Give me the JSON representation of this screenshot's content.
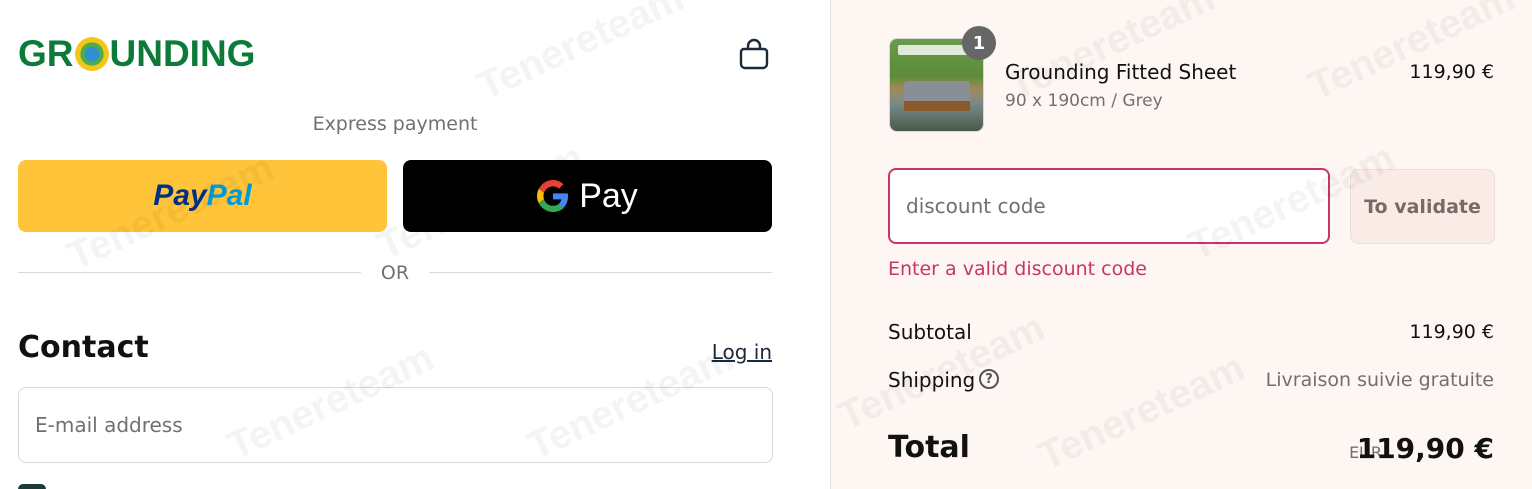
{
  "brand": {
    "logo_text_before": "GR",
    "logo_text_after": "UNDING",
    "color": "#0d7a3a"
  },
  "header": {
    "cart_icon": "shopping-bag-icon"
  },
  "express": {
    "label": "Express payment",
    "paypal": {
      "part1": "Pay",
      "part2": "Pal",
      "color": "#ffc439"
    },
    "gpay": {
      "label": "Pay",
      "icon": "google-g-icon"
    }
  },
  "divider": {
    "label": "OR"
  },
  "contact": {
    "title": "Contact",
    "login_label": "Log in",
    "email_placeholder": "E-mail address"
  },
  "order": {
    "quantity_badge": "1",
    "product_name": "Grounding Fitted Sheet",
    "variant": "90 x 190cm / Grey",
    "price": "119,90 €"
  },
  "discount": {
    "placeholder": "discount code",
    "button_label": "To validate",
    "error": "Enter a valid discount code",
    "error_color": "#c9356b"
  },
  "summary": {
    "subtotal_label": "Subtotal",
    "subtotal_value": "119,90 €",
    "shipping_label": "Shipping",
    "shipping_value": "Livraison suivie gratuite",
    "total_label": "Total",
    "currency": "EUR",
    "total_value": "119,90 €"
  },
  "watermark": {
    "text": "Tenereteam"
  }
}
